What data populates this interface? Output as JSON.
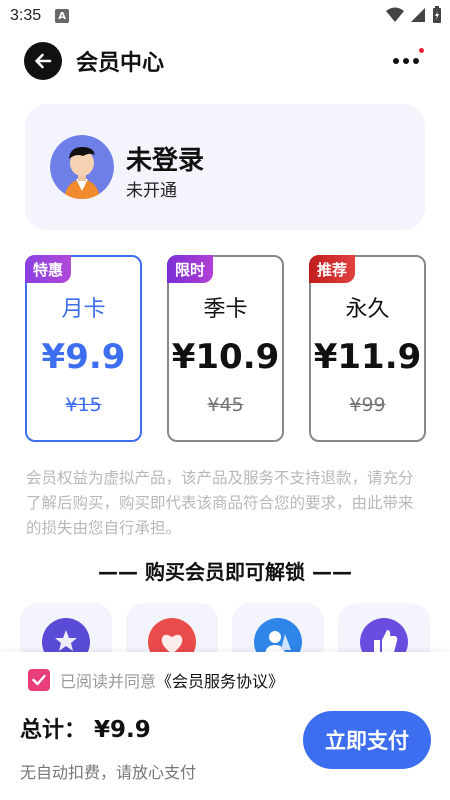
{
  "status_bar": {
    "time": "3:35",
    "notification_badge": "A"
  },
  "header": {
    "title": "会员中心"
  },
  "user": {
    "name": "未登录",
    "status": "未开通"
  },
  "plans": [
    {
      "tag": "特惠",
      "tag_color": "#7b3fe0",
      "name": "月卡",
      "price": "¥9.9",
      "original_price": "¥15",
      "selected": true
    },
    {
      "tag": "限时",
      "tag_color": "#8a35d8",
      "name": "季卡",
      "price": "¥10.9",
      "original_price": "¥45",
      "selected": false
    },
    {
      "tag": "推荐",
      "tag_color": "#d32a2a",
      "name": "永久",
      "price": "¥11.9",
      "original_price": "¥99",
      "selected": false
    }
  ],
  "notice": "会员权益为虚拟产品，该产品及服务不支持退款，请充分了解后购买，购买即代表该商品符合您的要求，由此带来的损失由您自行承担。",
  "unlock_title": "—— 购买会员即可解锁 ——",
  "benefits": [
    {
      "icon": "medal-icon",
      "color": "#5a4bd6"
    },
    {
      "icon": "heart-icon",
      "color": "#ea4b4b"
    },
    {
      "icon": "user-group-icon",
      "color": "#2f86e8"
    },
    {
      "icon": "thumbs-up-icon",
      "color": "#6a4ce0"
    }
  ],
  "agreement": {
    "checked": true,
    "prefix": "已阅读并同意",
    "link": "《会员服务协议》"
  },
  "checkout": {
    "total_label": "总计：",
    "total_amount": "¥9.9",
    "tip": "无自动扣费，请放心支付",
    "pay_label": "立即支付"
  },
  "colors": {
    "accent": "#3d6ef0",
    "checkbox": "#e83d7a",
    "card_bg": "#f3f4fc"
  }
}
